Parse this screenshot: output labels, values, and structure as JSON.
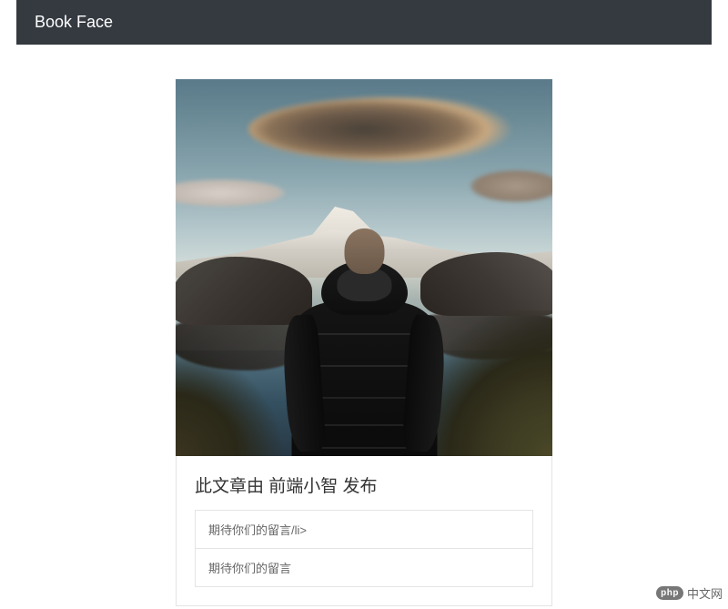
{
  "navbar": {
    "brand": "Book Face"
  },
  "post": {
    "title": "此文章由 前端小智 发布",
    "comments": [
      "期待你们的留言/li>",
      "期待你们的留言"
    ]
  },
  "watermark": {
    "badge": "php",
    "text": "中文网"
  }
}
